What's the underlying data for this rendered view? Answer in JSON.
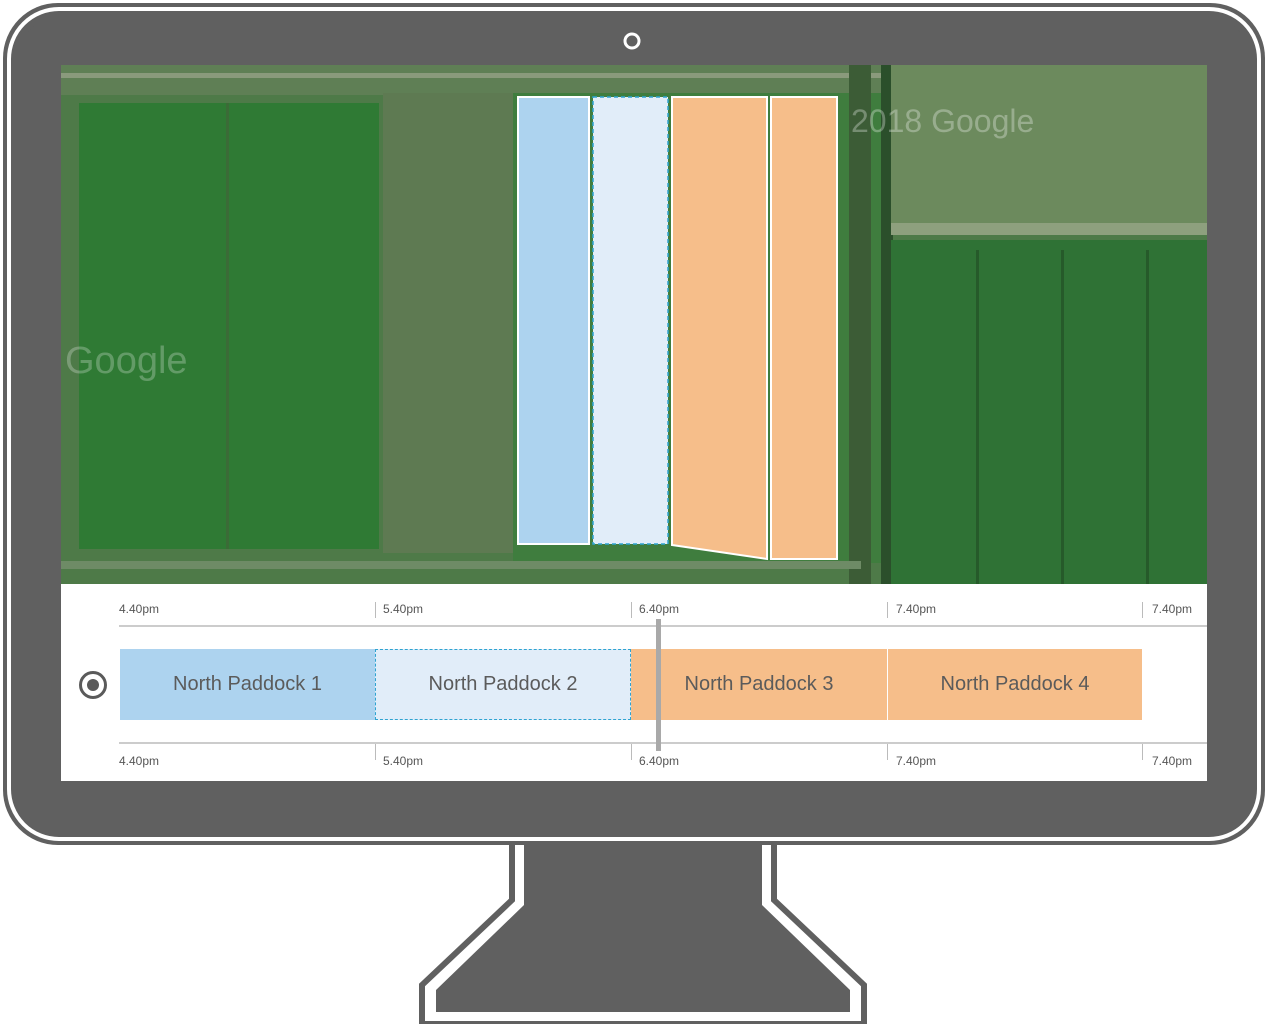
{
  "timeline": {
    "top_ticks": [
      "4.40pm",
      "5.40pm",
      "6.40pm",
      "7.40pm",
      "7.40pm"
    ],
    "bottom_ticks": [
      "4.40pm",
      "5.40pm",
      "6.40pm",
      "7.40pm",
      "7.40pm"
    ],
    "segments": [
      {
        "label": "North Paddock 1",
        "color": "#add3ef",
        "state": "completed"
      },
      {
        "label": "North Paddock 2",
        "color": "#e1edf9",
        "state": "selected"
      },
      {
        "label": "North Paddock 3",
        "color": "#f6be8a",
        "state": "upcoming"
      },
      {
        "label": "North Paddock 4",
        "color": "#f6be8a",
        "state": "upcoming"
      }
    ],
    "playhead_time": "6.40pm"
  },
  "map": {
    "watermark_1": "Google",
    "watermark_2": "2018 Google"
  },
  "colors": {
    "bezel": "#606060",
    "field": "#3c7d3a",
    "completed": "#add3ef",
    "selected": "#e1edf9",
    "selected_border": "#2fa3d1",
    "upcoming": "#f6be8a"
  },
  "icons": [
    "camera-icon",
    "target-radio-icon"
  ]
}
